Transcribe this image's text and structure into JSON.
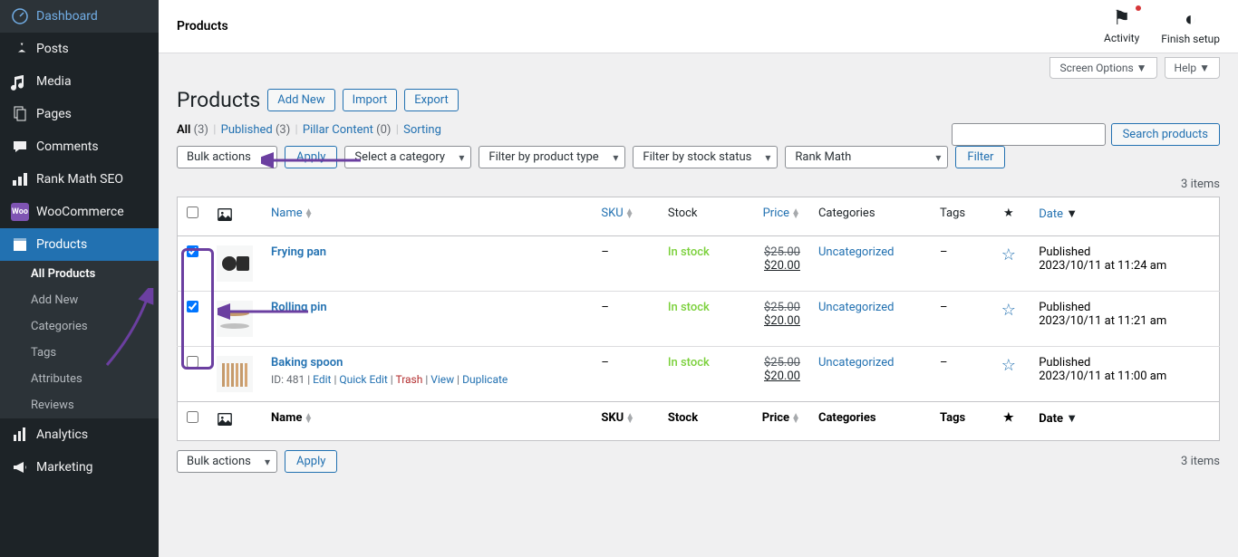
{
  "sidebar": {
    "items": [
      {
        "label": "Dashboard",
        "icon": "dashboard"
      },
      {
        "label": "Posts",
        "icon": "pin"
      },
      {
        "label": "Media",
        "icon": "media"
      },
      {
        "label": "Pages",
        "icon": "pages"
      },
      {
        "label": "Comments",
        "icon": "comments"
      },
      {
        "label": "Rank Math SEO",
        "icon": "rankmath"
      },
      {
        "label": "WooCommerce",
        "icon": "woo"
      },
      {
        "label": "Products",
        "icon": "products",
        "active": true
      },
      {
        "label": "Analytics",
        "icon": "analytics"
      },
      {
        "label": "Marketing",
        "icon": "marketing"
      }
    ],
    "submenu": [
      {
        "label": "All Products",
        "current": true
      },
      {
        "label": "Add New"
      },
      {
        "label": "Categories"
      },
      {
        "label": "Tags"
      },
      {
        "label": "Attributes"
      },
      {
        "label": "Reviews"
      }
    ]
  },
  "topbar": {
    "page": "Products",
    "actions": [
      {
        "label": "Activity",
        "icon": "flag"
      },
      {
        "label": "Finish setup",
        "icon": "circle"
      }
    ]
  },
  "screen_options": {
    "label": "Screen Options"
  },
  "help": {
    "label": "Help"
  },
  "heading": "Products",
  "heading_buttons": {
    "add_new": "Add New",
    "import": "Import",
    "export": "Export"
  },
  "subsubsub": {
    "all": {
      "label": "All",
      "count": "(3)"
    },
    "published": {
      "label": "Published",
      "count": "(3)"
    },
    "pillar": {
      "label": "Pillar Content",
      "count": "(0)"
    },
    "sorting": {
      "label": "Sorting"
    }
  },
  "filters": {
    "bulk": "Bulk actions",
    "apply": "Apply",
    "category": "Select a category",
    "product_type": "Filter by product type",
    "stock": "Filter by stock status",
    "rankmath": "Rank Math",
    "filter_btn": "Filter",
    "search_btn": "Search products"
  },
  "items_count": "3 items",
  "columns": {
    "name": "Name",
    "sku": "SKU",
    "stock": "Stock",
    "price": "Price",
    "categories": "Categories",
    "tags": "Tags",
    "date": "Date"
  },
  "rows": [
    {
      "checked": true,
      "name": "Frying pan",
      "sku": "–",
      "stock": "In stock",
      "old_price": "$25.00",
      "new_price": "$20.00",
      "category": "Uncategorized",
      "tags": "–",
      "date_status": "Published",
      "date": "2023/10/11 at 11:24 am"
    },
    {
      "checked": true,
      "name": "Rolling pin",
      "sku": "–",
      "stock": "In stock",
      "old_price": "$25.00",
      "new_price": "$20.00",
      "category": "Uncategorized",
      "tags": "–",
      "date_status": "Published",
      "date": "2023/10/11 at 11:21 am"
    },
    {
      "checked": false,
      "name": "Baking spoon",
      "id_label": "ID: 481",
      "actions": {
        "edit": "Edit",
        "quick": "Quick Edit",
        "trash": "Trash",
        "view": "View",
        "dup": "Duplicate"
      },
      "sku": "–",
      "stock": "In stock",
      "old_price": "$25.00",
      "new_price": "$20.00",
      "category": "Uncategorized",
      "tags": "–",
      "date_status": "Published",
      "date": "2023/10/11 at 11:00 am"
    }
  ],
  "bottom": {
    "bulk": "Bulk actions",
    "apply": "Apply",
    "items_count": "3 items"
  }
}
